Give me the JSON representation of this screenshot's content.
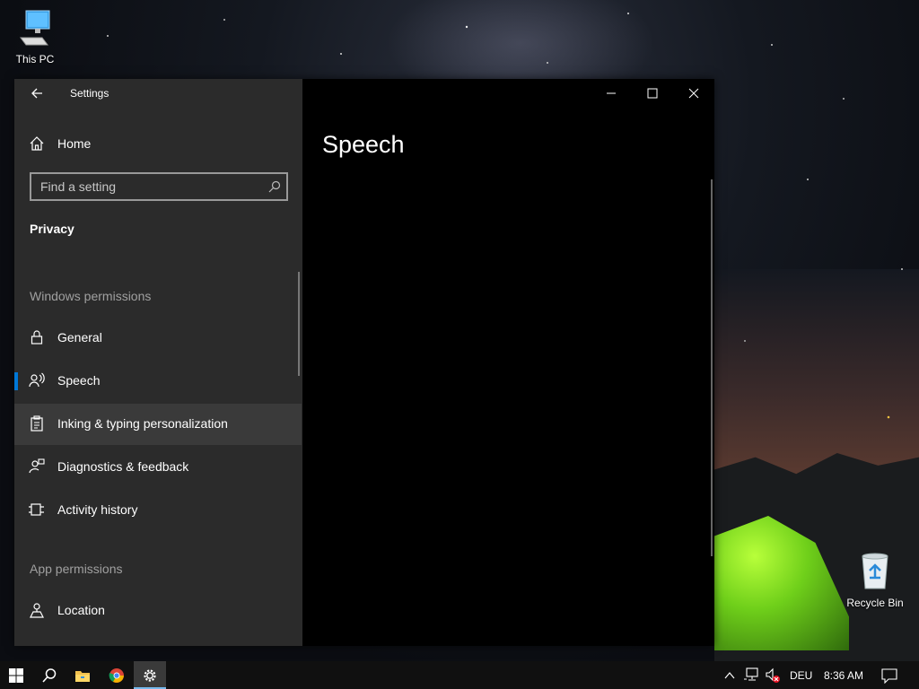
{
  "desktop": {
    "icons": [
      {
        "label": "This PC",
        "icon": "monitor-icon"
      },
      {
        "label": "Recycle Bin",
        "icon": "recycle-bin-icon"
      }
    ]
  },
  "window": {
    "title": "Settings",
    "back_icon": "back-arrow-icon",
    "controls": [
      "minimize-icon",
      "maximize-icon",
      "close-icon"
    ]
  },
  "sidebar": {
    "home_label": "Home",
    "search_placeholder": "Find a setting",
    "category": "Privacy",
    "section_windows": "Windows permissions",
    "items": [
      {
        "label": "General",
        "icon": "lock-icon"
      },
      {
        "label": "Speech",
        "icon": "speech-icon",
        "selected": true
      },
      {
        "label": "Inking & typing personalization",
        "icon": "clipboard-icon",
        "hover": true
      },
      {
        "label": "Diagnostics & feedback",
        "icon": "feedback-icon"
      },
      {
        "label": "Activity history",
        "icon": "timeline-icon"
      }
    ],
    "section_app": "App permissions",
    "app_items": [
      {
        "label": "Location",
        "icon": "location-icon"
      }
    ]
  },
  "main": {
    "page_title": "Speech"
  },
  "taskbar": {
    "apps": [
      "windows-start-icon",
      "search-icon",
      "file-explorer-icon",
      "chrome-icon",
      "settings-gear-icon"
    ],
    "language": "DEU",
    "time": "8:36 AM",
    "accent_color": "#0078d7"
  }
}
